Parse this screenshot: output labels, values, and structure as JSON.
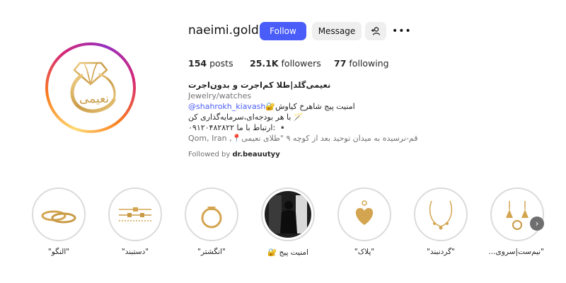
{
  "profile": {
    "username": "naeimi.gold",
    "follow_label": "Follow",
    "message_label": "Message",
    "posts_count": "154",
    "posts_label": "posts",
    "followers_count": "25.1K",
    "followers_label": "followers",
    "following_count": "77",
    "following_label": "following",
    "avatar_text": "نعیمی"
  },
  "bio": {
    "name": "نعیمی‌گلد|طلا کم‌اجرت و بدون‌اجرت",
    "category": "Jewelry/watches",
    "line1_prefix": "🔐امنیت پیج شاهرخ کیاوش",
    "mention": "@shahrokh_kiavash",
    "line2": "با هر بودجه‌ای،سرمایه‌گذاری کن 🪄",
    "line3": "۰۹۱۲۰۴۸۲۸۲۲ ارتباط با ما: ▪️",
    "address": "Qom, Iran ,📍قم-نرسیده به میدان توحید بعد از کوچه ۹ \"طلای نعیمی",
    "followed_by_prefix": "Followed by",
    "followed_by_user": "dr.beauutyy"
  },
  "highlights": [
    {
      "label": "\"النگو\"",
      "icon": "bangles-icon"
    },
    {
      "label": "\"دستبند\"",
      "icon": "bracelets-icon"
    },
    {
      "label": "\"انگشتر\"",
      "icon": "ring-icon"
    },
    {
      "label": "امنیت پیج 🔐",
      "icon": "person-photo-icon"
    },
    {
      "label": "\"پلاک\"",
      "icon": "heart-pendant-icon"
    },
    {
      "label": "\"گردنبند\"",
      "icon": "necklace-icon"
    },
    {
      "label": "\"نیم‌ست|سروی...",
      "icon": "earrings-set-icon"
    }
  ],
  "colors": {
    "follow_button": "#4a5df9",
    "gold": "#d4a550"
  }
}
